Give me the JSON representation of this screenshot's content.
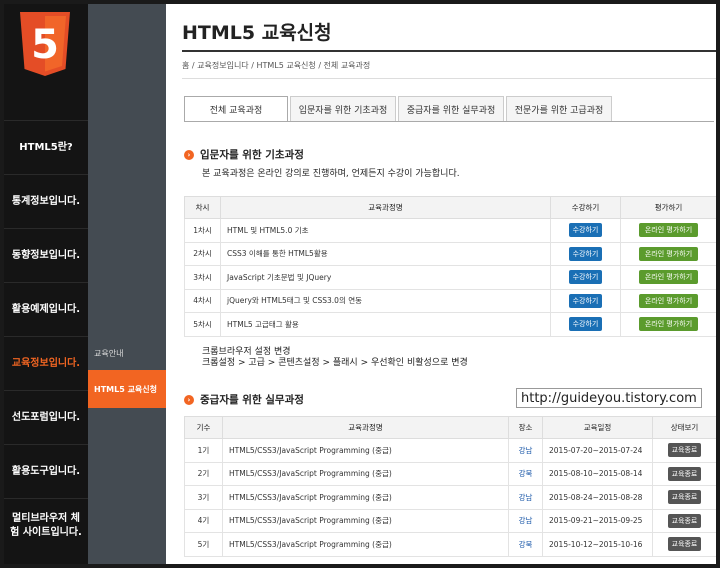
{
  "left_nav": {
    "logo_text": "5",
    "items": [
      {
        "label": "HTML5란?",
        "active": false
      },
      {
        "label": "통계정보입니다.",
        "active": false
      },
      {
        "label": "동향정보입니다.",
        "active": false
      },
      {
        "label": "활용예제입니다.",
        "active": false
      },
      {
        "label": "교육정보입니다.",
        "active": true
      },
      {
        "label": "선도포럼입니다.",
        "active": false
      },
      {
        "label": "활용도구입니다.",
        "active": false
      },
      {
        "label": "멀티브라우저 체험 사이트입니다.",
        "active": false
      }
    ]
  },
  "sub_nav": {
    "items": [
      {
        "label": "교육안내",
        "active": false
      },
      {
        "label": "HTML5 교육신청",
        "active": true
      }
    ]
  },
  "page": {
    "title": "HTML5 교육신청",
    "breadcrumb": "홈 / 교육정보입니다 / HTML5 교육신청 / 전체 교육과정"
  },
  "tabs": [
    {
      "label": "전체 교육과정",
      "active": true
    },
    {
      "label": "입문자를 위한 기초과정",
      "active": false
    },
    {
      "label": "중급자를 위한 실무과정",
      "active": false
    },
    {
      "label": "전문가를 위한 고급과정",
      "active": false
    }
  ],
  "section1": {
    "title": "입문자를 위한 기초과정",
    "description": "본 교육과정은 온라인 강의로 진행하며, 언제든지 수강이 가능합니다.",
    "headers": [
      "차시",
      "교육과정명",
      "수강하기",
      "평가하기"
    ],
    "rows": [
      {
        "no": "1차시",
        "name": "HTML 및 HTML5.0 기초",
        "enroll": "수강하기",
        "eval": "온라인 평가하기"
      },
      {
        "no": "2차시",
        "name": "CSS3 이해를 통한 HTML5활용",
        "enroll": "수강하기",
        "eval": "온라인 평가하기"
      },
      {
        "no": "3차시",
        "name": "JavaScript 기초문법 및 JQuery",
        "enroll": "수강하기",
        "eval": "온라인 평가하기"
      },
      {
        "no": "4차시",
        "name": "jQuery와 HTML5태그 및 CSS3.0의 연동",
        "enroll": "수강하기",
        "eval": "온라인 평가하기"
      },
      {
        "no": "5차시",
        "name": "HTML5 고급태그 활용",
        "enroll": "수강하기",
        "eval": "온라인 평가하기"
      }
    ],
    "tip_line1": "크롬브라우저 설정 변경",
    "tip_line2": "크롬설정 > 고급 > 콘텐츠설정 > 플래시 > 우선확인 비활성으로 변경"
  },
  "section2": {
    "title": "중급자를 위한 실무과정",
    "headers": [
      "기수",
      "교육과정명",
      "장소",
      "교육일정",
      "상태보기"
    ],
    "rows": [
      {
        "no": "1기",
        "name": "HTML5/CSS3/JavaScript Programming (중급)",
        "place": "강남",
        "date": "2015-07-20~2015-07-24",
        "status": "교육종료"
      },
      {
        "no": "2기",
        "name": "HTML5/CSS3/JavaScript Programming (중급)",
        "place": "강북",
        "date": "2015-08-10~2015-08-14",
        "status": "교육종료"
      },
      {
        "no": "3기",
        "name": "HTML5/CSS3/JavaScript Programming (중급)",
        "place": "강남",
        "date": "2015-08-24~2015-08-28",
        "status": "교육종료"
      },
      {
        "no": "4기",
        "name": "HTML5/CSS3/JavaScript Programming (중급)",
        "place": "강남",
        "date": "2015-09-21~2015-09-25",
        "status": "교육종료"
      },
      {
        "no": "5기",
        "name": "HTML5/CSS3/JavaScript Programming (중급)",
        "place": "강북",
        "date": "2015-10-12~2015-10-16",
        "status": "교육종료"
      }
    ]
  },
  "watermark": "http://guideyou.tistory.com",
  "colors": {
    "accent": "#f26522",
    "blue_button": "#1a6fb5",
    "green_button": "#5b9b2d"
  }
}
